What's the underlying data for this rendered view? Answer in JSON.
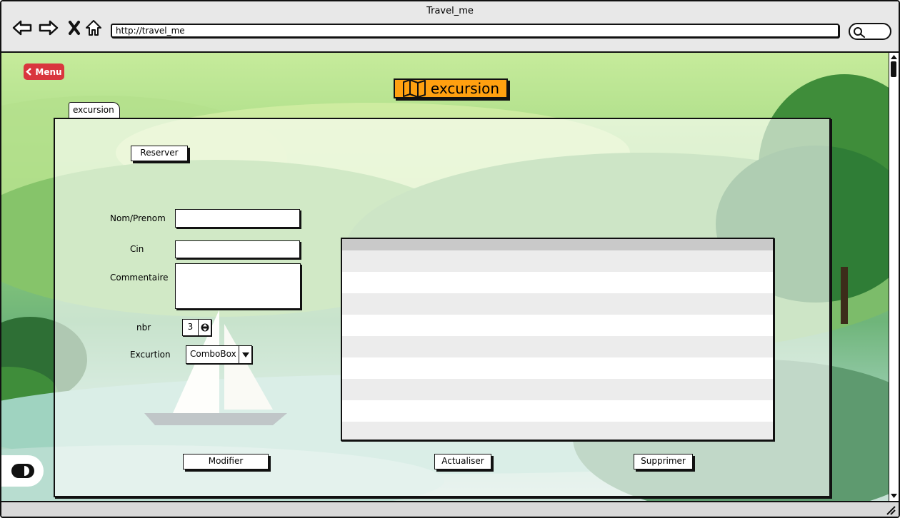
{
  "browser": {
    "title": "Travel_me",
    "url": "http://travel_me",
    "icons": [
      "back-arrow-icon",
      "forward-arrow-icon",
      "close-x-icon",
      "home-icon",
      "search-icon"
    ]
  },
  "app": {
    "menu_label": "Menu",
    "heading": "excursion",
    "heading_icon": "map-icon",
    "tab_label": "excursion",
    "accent_colors": {
      "menu": "#d9363e",
      "heading": "#ffa010"
    }
  },
  "form": {
    "reserver_label": "Reserver",
    "nom_label": "Nom/Prenom",
    "nom_value": "",
    "cin_label": "Cin",
    "cin_value": "",
    "commentaire_label": "Commentaire",
    "commentaire_value": "",
    "nbr_label": "nbr",
    "nbr_value": "3",
    "excursion_label": "Excurtion",
    "excursion_value": "ComboBox"
  },
  "table": {
    "columns": [],
    "rows": [
      [],
      [],
      [],
      [],
      [],
      [],
      [],
      [],
      []
    ]
  },
  "actions": {
    "modifier_label": "Modifier",
    "actualiser_label": "Actualiser",
    "supprimer_label": "Supprimer"
  }
}
